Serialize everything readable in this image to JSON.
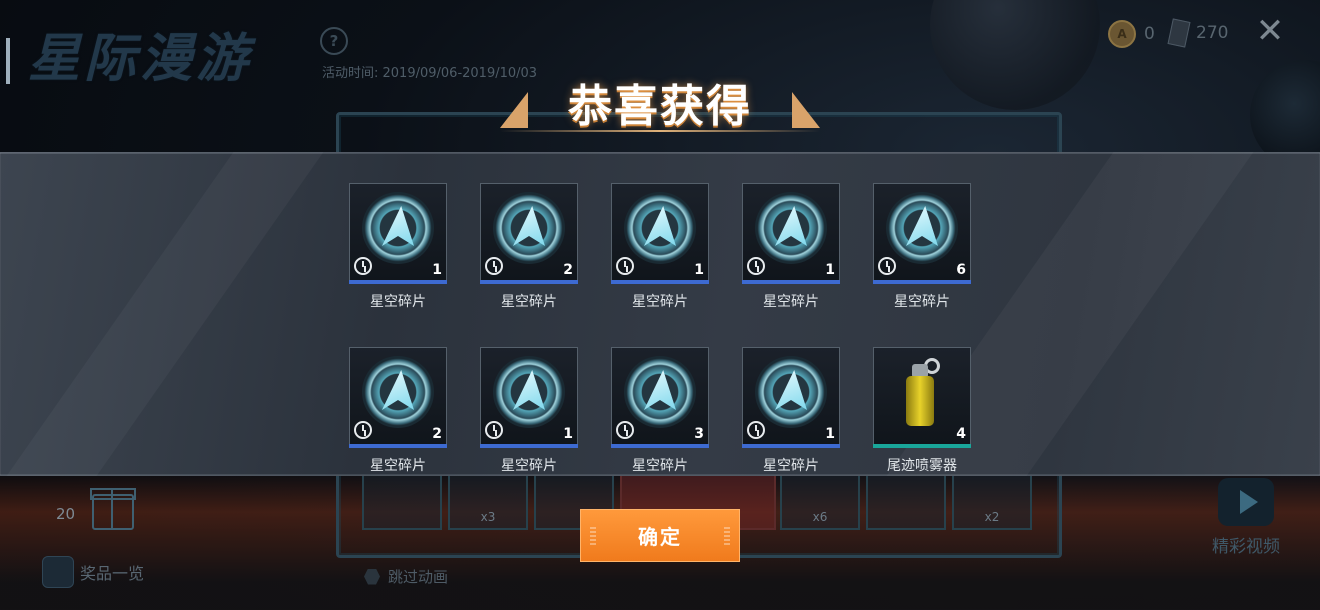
{
  "event": {
    "title": "星际漫游",
    "time": "活动时间: 2019/09/06-2019/10/03"
  },
  "currency": [
    {
      "icon": "coin-icon",
      "value": "0"
    },
    {
      "icon": "card-icon",
      "value": "270"
    }
  ],
  "dialog": {
    "title": "恭喜获得",
    "items": [
      {
        "name": "星空碎片",
        "qty": "1",
        "icon": "star-shard-icon",
        "rarity_color": "#3d6ad1"
      },
      {
        "name": "星空碎片",
        "qty": "2",
        "icon": "star-shard-icon",
        "rarity_color": "#3d6ad1"
      },
      {
        "name": "星空碎片",
        "qty": "1",
        "icon": "star-shard-icon",
        "rarity_color": "#3d6ad1"
      },
      {
        "name": "星空碎片",
        "qty": "1",
        "icon": "star-shard-icon",
        "rarity_color": "#3d6ad1"
      },
      {
        "name": "星空碎片",
        "qty": "6",
        "icon": "star-shard-icon",
        "rarity_color": "#3d6ad1"
      },
      {
        "name": "星空碎片",
        "qty": "2",
        "icon": "star-shard-icon",
        "rarity_color": "#3d6ad1"
      },
      {
        "name": "星空碎片",
        "qty": "1",
        "icon": "star-shard-icon",
        "rarity_color": "#3d6ad1"
      },
      {
        "name": "星空碎片",
        "qty": "3",
        "icon": "star-shard-icon",
        "rarity_color": "#3d6ad1"
      },
      {
        "name": "星空碎片",
        "qty": "1",
        "icon": "star-shard-icon",
        "rarity_color": "#3d6ad1"
      },
      {
        "name": "尾迹喷雾器",
        "qty": "4",
        "icon": "trail-sprayer-icon",
        "rarity_color": "#19a69a"
      }
    ],
    "confirm_label": "确定"
  },
  "background": {
    "slot_labels": [
      "x3",
      "x6",
      "x2"
    ],
    "left_count": "20",
    "prize_list_label": "奖品一览",
    "skip_label": "跳过动画",
    "video_label": "精彩视频"
  },
  "colors": {
    "accent": "#f07a1c",
    "rarity_blue": "#3d6ad1",
    "rarity_teal": "#19a69a"
  }
}
